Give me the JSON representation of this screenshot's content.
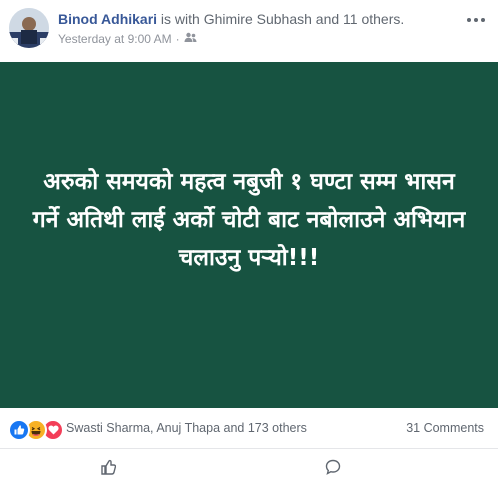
{
  "header": {
    "author": "Binod Adhikari",
    "with_text": " is with Ghimire Subhash and 11 others.",
    "timestamp": "Yesterday at 9:00 AM",
    "separator": "·",
    "audience_icon": "friends-icon",
    "more_icon": "more-options-icon"
  },
  "post": {
    "background_color": "#175341",
    "text": "अरुको समयको महत्व नबुजी १ घण्टा सम्म भासन गर्ने अतिथी लाई अर्को चोटी बाट नबोलाउने अभियान चलाउनु पर्‍यो!!!"
  },
  "reactions": {
    "icons": [
      "like-icon",
      "haha-icon",
      "love-icon"
    ],
    "names": "Swasti Sharma, Anuj Thapa and 173 others",
    "comments": "31 Comments"
  },
  "actions": {
    "icons": [
      "like-action-icon",
      "comment-action-icon"
    ]
  }
}
